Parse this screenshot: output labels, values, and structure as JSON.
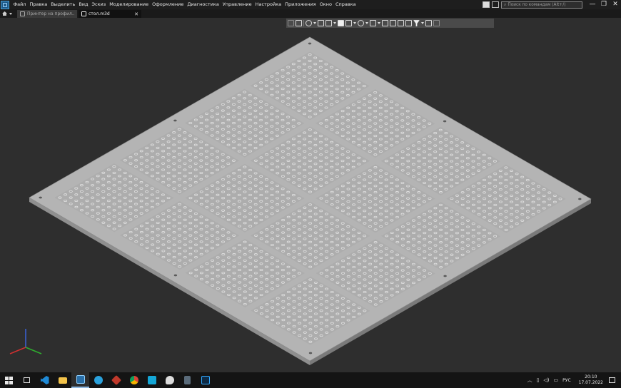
{
  "menubar": {
    "items": [
      "Файл",
      "Правка",
      "Выделить",
      "Вид",
      "Эскиз",
      "Моделирование",
      "Оформление",
      "Диагностика",
      "Управление",
      "Настройка",
      "Приложения",
      "Окно",
      "Справка"
    ],
    "search_placeholder": "Поиск по командам (Alt+/)",
    "window_controls": [
      "—",
      "❐",
      "✕"
    ]
  },
  "tabs": [
    {
      "label": "Принтер на профил...",
      "active": false
    },
    {
      "label": "стол.m3d",
      "active": true,
      "close": "✕"
    }
  ],
  "view_toolbar": {
    "icons": [
      "grid-icon",
      "sketch-plane-icon",
      "zoom-icon",
      "pan-icon",
      "axes-icon",
      "solid-view-icon",
      "wireframe-view-icon",
      "hide-icon",
      "section-icon",
      "rotate-icon",
      "orient-icon",
      "layers-icon",
      "display-icon",
      "filter-icon",
      "measure-icon",
      "eyedropper-icon"
    ]
  },
  "model": {
    "plate_color": "#b4b4b4",
    "hole_color": "#e6e6e6",
    "edge_color": "#8c8c8c",
    "grid_size": 4
  },
  "triad": {
    "x_color": "#d03030",
    "y_color": "#2fae2f",
    "z_color": "#3a62d8"
  },
  "taskbar": {
    "apps": [
      "windows-start-icon",
      "task-view-icon",
      "vscode-icon",
      "file-explorer-icon",
      "kompas-icon",
      "telegram-icon",
      "app-icon",
      "chrome-icon",
      "cursa-icon",
      "paint-icon",
      "calculator-icon",
      "photoshop-icon"
    ],
    "tray_language": "РУС",
    "time": "20:10",
    "date": "17.07.2022"
  }
}
